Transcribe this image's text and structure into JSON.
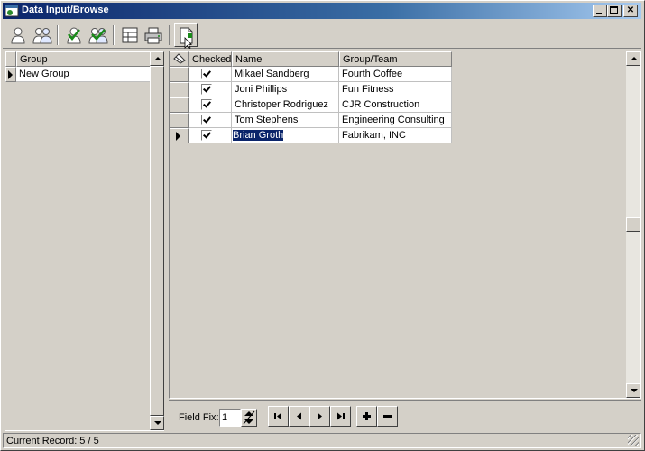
{
  "window": {
    "title": "Data Input/Browse"
  },
  "toolbar": {
    "buttons": [
      {
        "name": "single-person-icon"
      },
      {
        "name": "multiple-persons-icon"
      },
      {
        "name": "person-check-icon"
      },
      {
        "name": "persons-check-icon"
      },
      {
        "name": "layout-icon"
      },
      {
        "name": "print-icon"
      },
      {
        "name": "new-document-icon"
      }
    ]
  },
  "left_grid": {
    "header": "Group",
    "rows": [
      "New Group"
    ]
  },
  "main_grid": {
    "columns": [
      "Checked",
      "Name",
      "Group/Team"
    ],
    "rows": [
      {
        "checked": true,
        "name": "Mikael Sandberg",
        "group": "Fourth Coffee"
      },
      {
        "checked": true,
        "name": "Joni Phillips",
        "group": "Fun Fitness"
      },
      {
        "checked": true,
        "name": "Christoper Rodriguez",
        "group": "CJR Construction"
      },
      {
        "checked": true,
        "name": "Tom Stephens",
        "group": "Engineering Consulting"
      },
      {
        "checked": true,
        "name": "Brian Groth",
        "group": "Fabrikam, INC"
      }
    ],
    "current_row": 5
  },
  "navigator": {
    "field_fix_label": "Field Fix:",
    "field_fix_value": "1"
  },
  "status": {
    "text": "Current Record: 5 / 5"
  },
  "colors": {
    "titlebar_start": "#0a246a",
    "face": "#d4d0c8",
    "selection": "#0a246a"
  }
}
